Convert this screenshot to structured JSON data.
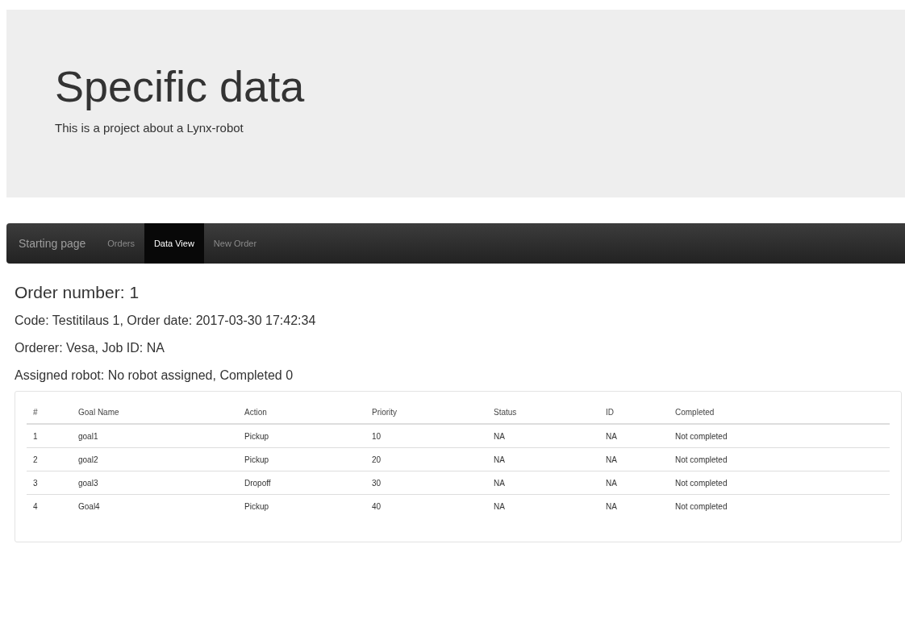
{
  "header": {
    "title": "Specific data",
    "subtitle": "This is a project about a Lynx-robot"
  },
  "navbar": {
    "brand": "Starting page",
    "items": [
      {
        "label": "Orders",
        "selected": false
      },
      {
        "label": "Data View",
        "selected": true
      },
      {
        "label": "New Order",
        "selected": false
      }
    ]
  },
  "order": {
    "heading": "Order number: 1",
    "lines": [
      "Code: Testitilaus 1, Order date: 2017-03-30 17:42:34",
      "Orderer: Vesa, Job ID: NA",
      "Assigned robot: No robot assigned, Completed 0"
    ]
  },
  "table": {
    "columns": [
      "#",
      "Goal Name",
      "Action",
      "Priority",
      "Status",
      "ID",
      "Completed"
    ],
    "rows": [
      [
        "1",
        "goal1",
        "Pickup",
        "10",
        "NA",
        "NA",
        "Not completed"
      ],
      [
        "2",
        "goal2",
        "Pickup",
        "20",
        "NA",
        "NA",
        "Not completed"
      ],
      [
        "3",
        "goal3",
        "Dropoff",
        "30",
        "NA",
        "NA",
        "Not completed"
      ],
      [
        "4",
        "Goal4",
        "Pickup",
        "40",
        "NA",
        "NA",
        "Not completed"
      ]
    ]
  }
}
